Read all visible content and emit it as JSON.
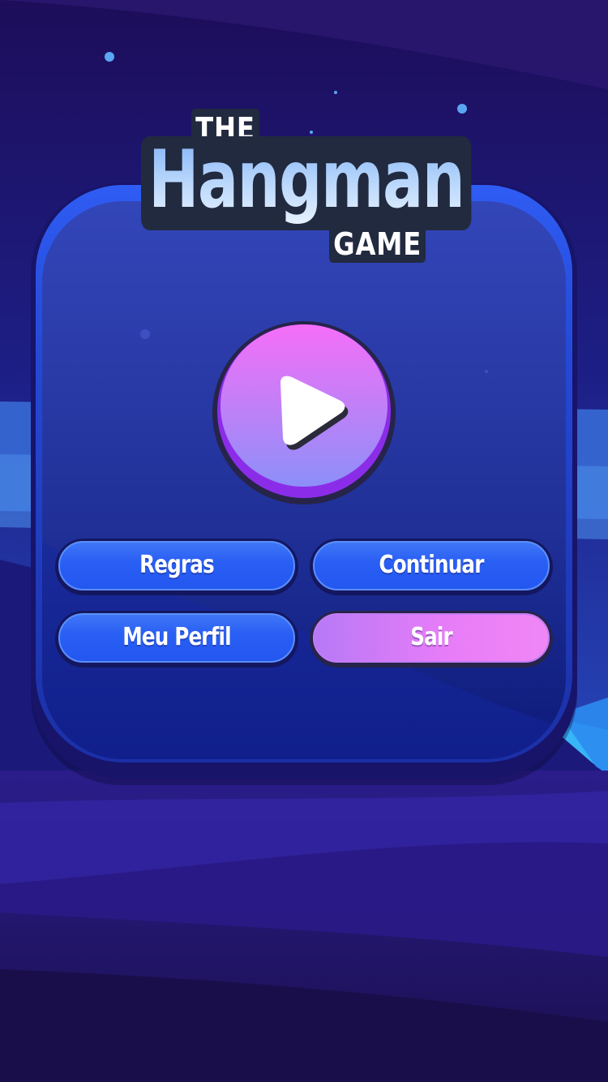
{
  "logo": {
    "line1": "THE",
    "line2": "Hangman",
    "line3": "GAME"
  },
  "play_button": {
    "icon": "play-icon"
  },
  "menu": {
    "rules_label": "Regras",
    "continue_label": "Continuar",
    "profile_label": "Meu Perfil",
    "exit_label": "Sair"
  },
  "colors": {
    "primary_button": "#2a5ff4",
    "exit_button": "#e77cf8",
    "play_button": "#c77ef7",
    "panel": "#2a3ba8"
  }
}
